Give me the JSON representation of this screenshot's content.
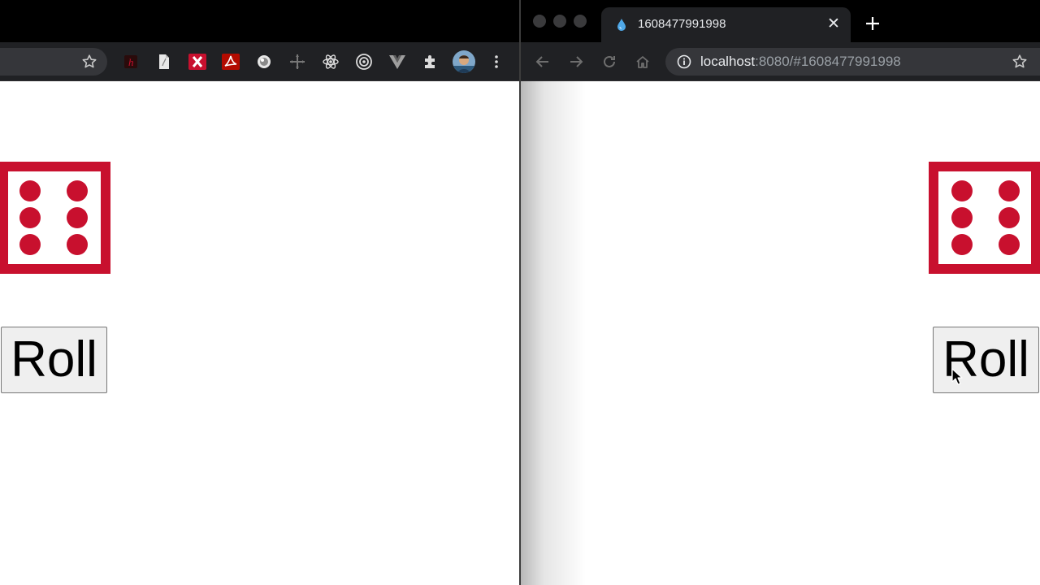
{
  "left_window": {
    "die": {
      "face_value": 6,
      "color": "#c8102e"
    },
    "roll_button": {
      "label": "Roll"
    },
    "extensions": [
      "star-icon",
      "h-extension-icon",
      "document-extension-icon",
      "x-extension-icon",
      "acrobat-extension-icon",
      "lens-extension-icon",
      "move-extension-icon",
      "react-devtools-icon",
      "target-extension-icon",
      "vue-devtools-icon",
      "puzzle-icon",
      "profile-avatar",
      "kebab-menu-icon"
    ]
  },
  "right_window": {
    "tab": {
      "title": "1608477991998",
      "favicon": "droplet-icon"
    },
    "address_bar": {
      "host": "localhost",
      "rest": ":8080/#1608477991998"
    },
    "die": {
      "face_value": 6,
      "color": "#c8102e"
    },
    "roll_button": {
      "label": "Roll"
    }
  },
  "colors": {
    "accent": "#c8102e",
    "toolbar": "#202124",
    "tabstrip": "#000000"
  }
}
